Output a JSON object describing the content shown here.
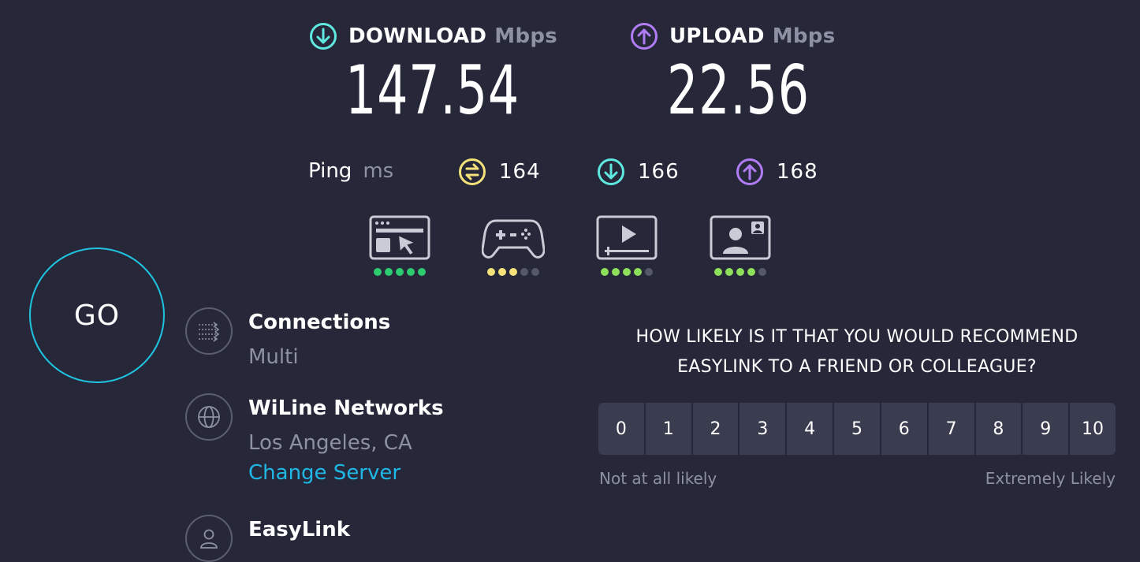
{
  "colors": {
    "background": "#262839",
    "download_accent": "#5ee8e0",
    "upload_accent": "#b07cf6",
    "ping_accent": "#f5e27a",
    "go_ring": "#1fc4e0",
    "link": "#1fb7e6",
    "muted": "#8e90a4",
    "dot_green": "#2ecc71",
    "dot_lime": "#8ee05a",
    "dot_yellow": "#f5e27a",
    "dot_off": "#55586a"
  },
  "download": {
    "label": "DOWNLOAD",
    "unit": "Mbps",
    "value": "147.54",
    "icon": "arrow-down-circle-icon"
  },
  "upload": {
    "label": "UPLOAD",
    "unit": "Mbps",
    "value": "22.56",
    "icon": "arrow-up-circle-icon"
  },
  "ping": {
    "label": "Ping",
    "unit": "ms",
    "idle": {
      "icon": "ping-idle-icon",
      "value": "164"
    },
    "download": {
      "icon": "ping-download-icon",
      "value": "166"
    },
    "upload": {
      "icon": "ping-upload-icon",
      "value": "168"
    }
  },
  "quality": [
    {
      "icon": "web-browsing-icon",
      "rating": 5,
      "max": 5,
      "color": "#2ecc71"
    },
    {
      "icon": "gaming-controller-icon",
      "rating": 3,
      "max": 5,
      "color": "#f5e27a"
    },
    {
      "icon": "video-streaming-icon",
      "rating": 4,
      "max": 5,
      "color": "#8ee05a"
    },
    {
      "icon": "video-call-icon",
      "rating": 4,
      "max": 5,
      "color": "#8ee05a"
    }
  ],
  "go_label": "GO",
  "connections": {
    "title": "Connections",
    "value": "Multi",
    "icon": "connections-icon"
  },
  "server": {
    "title": "WiLine Networks",
    "location": "Los Angeles, CA",
    "change_label": "Change Server",
    "icon": "globe-icon"
  },
  "provider": {
    "title": "EasyLink",
    "icon": "user-icon"
  },
  "survey": {
    "question_line1": "HOW LIKELY IS IT THAT YOU WOULD RECOMMEND",
    "question_line2": "EASYLINK TO A FRIEND OR COLLEAGUE?",
    "scale": [
      "0",
      "1",
      "2",
      "3",
      "4",
      "5",
      "6",
      "7",
      "8",
      "9",
      "10"
    ],
    "low_label": "Not at all likely",
    "high_label": "Extremely Likely"
  }
}
